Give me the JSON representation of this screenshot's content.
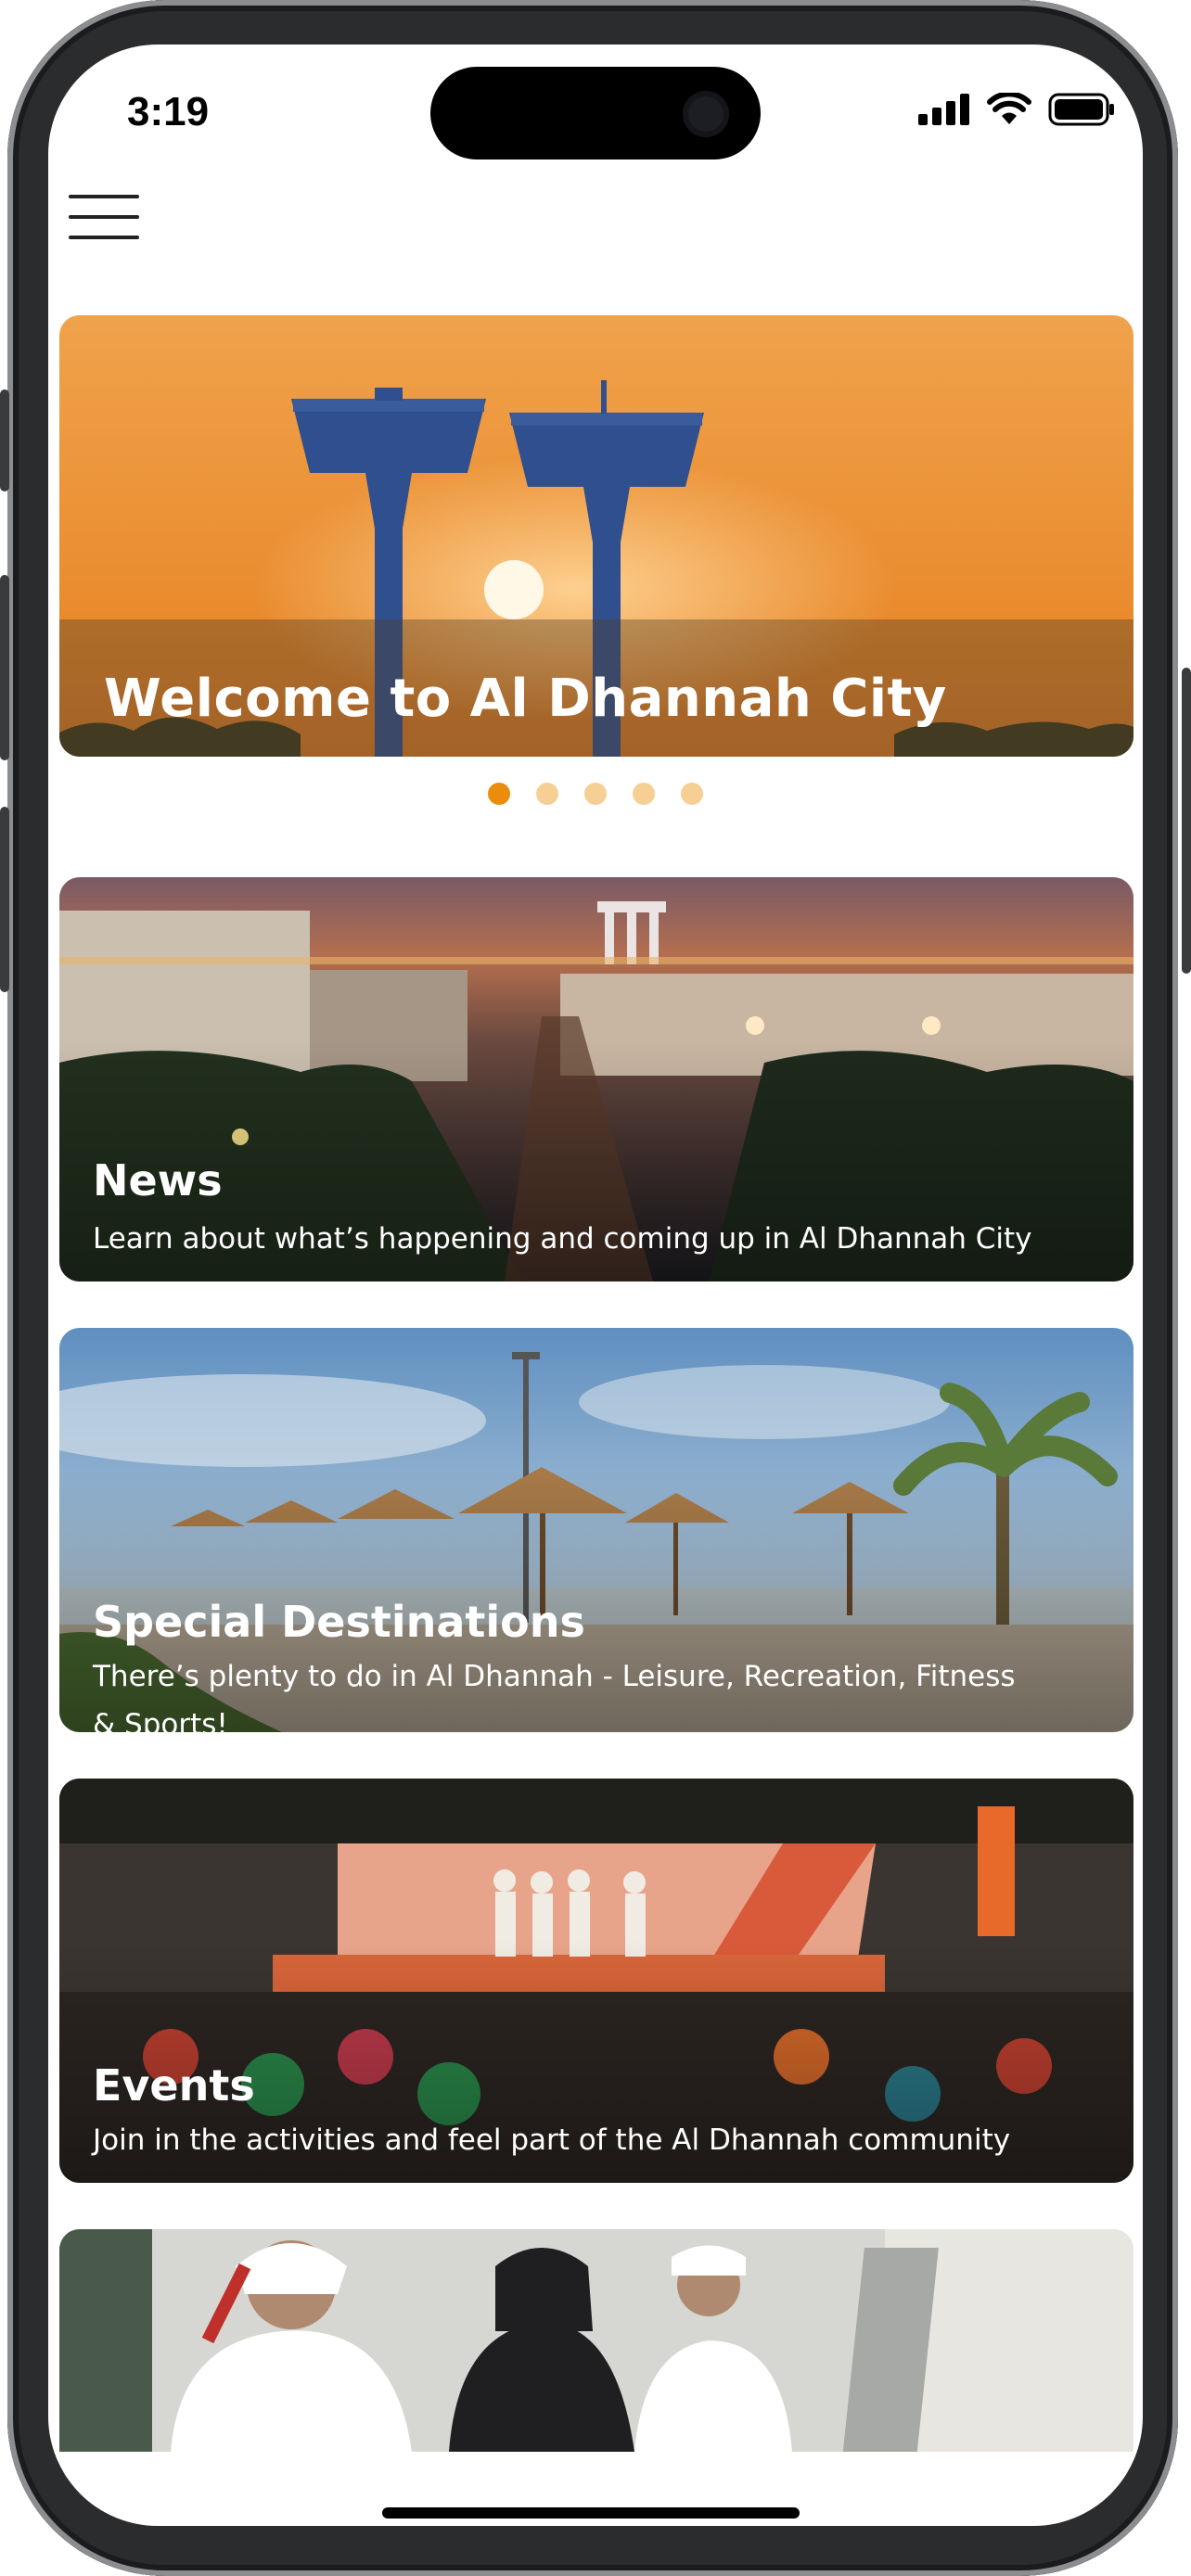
{
  "status_bar": {
    "time": "3:19"
  },
  "hero": {
    "title": "Welcome to Al Dhannah City",
    "slide_count": 5,
    "active_slide": 1
  },
  "cards": [
    {
      "title": "News",
      "description": "Learn about what’s happening and coming up in Al Dhannah City"
    },
    {
      "title": "Special Destinations",
      "description": "There’s plenty to do in Al Dhannah - Leisure, Recreation, Fitness & Sports!"
    },
    {
      "title": "Events",
      "description": "Join in the activities and feel part of the Al Dhannah community"
    }
  ],
  "colors": {
    "accent": "#ea8c0c",
    "dot_inactive": "#f6cf95",
    "hero_sky_top": "#f0a24c",
    "hero_sky_bottom": "#e98a2c",
    "tower": "#2f4f8e"
  },
  "icons": [
    "hamburger-menu-icon",
    "signal-icon",
    "wifi-icon",
    "battery-icon"
  ]
}
